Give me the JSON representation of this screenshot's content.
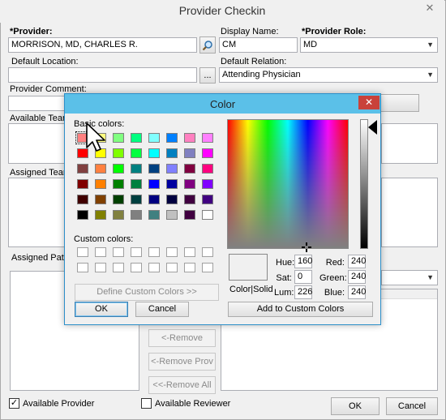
{
  "window": {
    "title": "Provider Checkin",
    "close_glyph": "✕"
  },
  "form": {
    "provider_label": "*Provider:",
    "provider_value": "MORRISON, MD, CHARLES R.",
    "display_name_label": "Display Name:",
    "display_name_value": "CM",
    "provider_role_label": "*Provider Role:",
    "provider_role_value": "MD",
    "default_location_label": "Default Location:",
    "default_location_value": "",
    "ellipsis_button": "...",
    "default_relation_label": "Default Relation:",
    "default_relation_value": "Attending Physician",
    "provider_comment_label": "Provider Comment:",
    "available_teams_label": "Available Teams:",
    "assigned_team_label": "Assigned Team L",
    "assigned_patients_label": "Assigned Patien",
    "remove_button": "<-Remove",
    "remove_prov_button": "<-Remove Prov",
    "remove_all_button": "<<-Remove All",
    "available_provider_label": "Available Provider",
    "available_provider_checked": true,
    "available_reviewer_label": "Available Reviewer",
    "available_reviewer_checked": false,
    "ok_button": "OK",
    "cancel_button": "Cancel"
  },
  "color_dialog": {
    "title": "Color",
    "basic_colors_label": "Basic colors:",
    "custom_colors_label": "Custom colors:",
    "define_custom_button": "Define Custom Colors >>",
    "ok_button": "OK",
    "cancel_button": "Cancel",
    "color_solid_label": "Color|Solid",
    "hue_label": "Hue:",
    "hue_value": "160",
    "sat_label": "Sat:",
    "sat_value": "0",
    "lum_label": "Lum:",
    "lum_value": "226",
    "red_label": "Red:",
    "red_value": "240",
    "green_label": "Green:",
    "green_value": "240",
    "blue_label": "Blue:",
    "blue_value": "240",
    "add_custom_button": "Add to Custom Colors",
    "selected_color": "#f0f0f0",
    "basic_colors": [
      [
        "#ff8080",
        "#ffff80",
        "#80ff80",
        "#00ff80",
        "#80ffff",
        "#0080ff",
        "#ff80c0",
        "#ff80ff"
      ],
      [
        "#ff0000",
        "#ffff00",
        "#80ff00",
        "#00ff40",
        "#00ffff",
        "#0080c0",
        "#8080c0",
        "#ff00ff"
      ],
      [
        "#804040",
        "#ff8040",
        "#00ff00",
        "#008080",
        "#004080",
        "#8080ff",
        "#800040",
        "#ff0080"
      ],
      [
        "#800000",
        "#ff8000",
        "#008000",
        "#008040",
        "#0000ff",
        "#0000a0",
        "#800080",
        "#8000ff"
      ],
      [
        "#400000",
        "#804000",
        "#004000",
        "#004040",
        "#000080",
        "#000040",
        "#400040",
        "#400080"
      ],
      [
        "#000000",
        "#808000",
        "#808040",
        "#808080",
        "#408080",
        "#c0c0c0",
        "#400040",
        "#ffffff"
      ]
    ]
  }
}
